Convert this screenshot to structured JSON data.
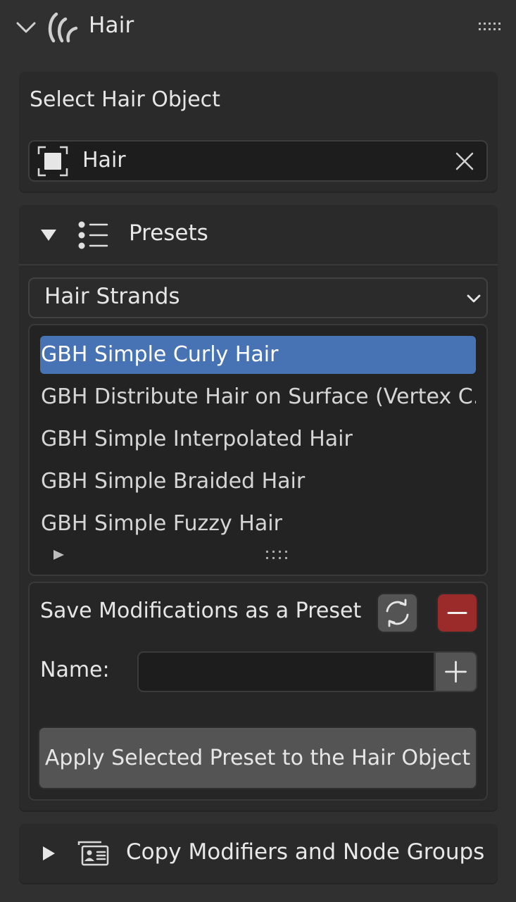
{
  "header": {
    "title": "Hair",
    "collapse_icon": "chevron-down-icon",
    "type_icon": "hair-curves-icon",
    "drag_icon": "grip-dots-icon"
  },
  "select_panel": {
    "label": "Select Hair Object",
    "object_icon": "object-select-icon",
    "object_value": "Hair",
    "clear_icon": "x-icon"
  },
  "presets_panel": {
    "title": "Presets",
    "expand_icon": "triangle-down-icon",
    "panel_icon": "list-icon",
    "category": {
      "selected": "Hair Strands"
    },
    "list": {
      "selected_index": 0,
      "items": [
        {
          "label": "GBH Simple Curly Hair"
        },
        {
          "label": "GBH Distribute Hair on Surface (Vertex C..."
        },
        {
          "label": "GBH Simple Interpolated Hair"
        },
        {
          "label": "GBH Simple Braided Hair"
        },
        {
          "label": "GBH Simple Fuzzy Hair"
        }
      ]
    },
    "save": {
      "label": "Save Modifications as a Preset",
      "refresh_icon": "refresh-icon",
      "remove_icon": "minus-icon",
      "name_label": "Name:",
      "name_value": "",
      "add_icon": "plus-icon",
      "apply_label": "Apply Selected Preset to the Hair Object"
    }
  },
  "copy_panel": {
    "title": "Copy Modifiers and Node Groups",
    "expand_icon": "triangle-right-icon",
    "panel_icon": "id-card-icon"
  },
  "colors": {
    "background": "#303030",
    "panel": "#2a2a2a",
    "selection": "#4772b3",
    "danger": "#9b2b2b",
    "button": "#545454"
  }
}
